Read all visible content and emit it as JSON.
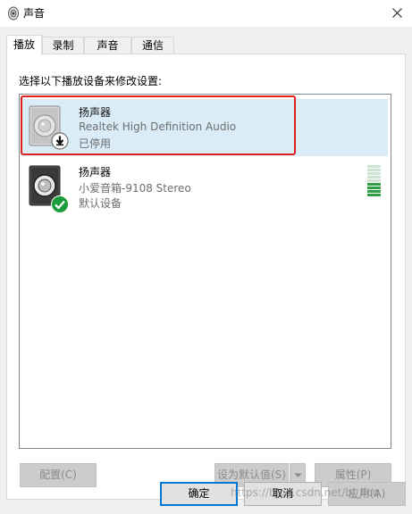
{
  "window": {
    "title": "声音"
  },
  "tabs": [
    {
      "label": "播放",
      "active": true
    },
    {
      "label": "录制",
      "active": false
    },
    {
      "label": "声音",
      "active": false
    },
    {
      "label": "通信",
      "active": false
    }
  ],
  "panel": {
    "instruction": "选择以下播放设备来修改设置:"
  },
  "devices": [
    {
      "name": "扬声器",
      "description": "Realtek High Definition Audio",
      "status": "已停用",
      "state": "disabled",
      "selected": true,
      "badge_icon": "down-arrow-icon"
    },
    {
      "name": "扬声器",
      "description": "小爱音箱-9108 Stereo",
      "status": "默认设备",
      "state": "default",
      "selected": false,
      "badge_icon": "check-icon",
      "level_meter_active_bars": 4,
      "level_meter_total_bars": 9
    }
  ],
  "buttons": {
    "configure": "配置(C)",
    "set_default": "设为默认值(S)",
    "properties": "属性(P)",
    "ok": "确定",
    "cancel": "取消",
    "apply": "应用(A)"
  },
  "colors": {
    "selection_bg": "#d9ecf7",
    "highlight_border": "#e0201c",
    "default_button_border": "#0078d7",
    "level_active": "#2f9e44",
    "level_inactive": "#cfe3d3",
    "check_badge": "#1a9c3a"
  },
  "watermark": "https://blog.csdn.net/bj_licq"
}
